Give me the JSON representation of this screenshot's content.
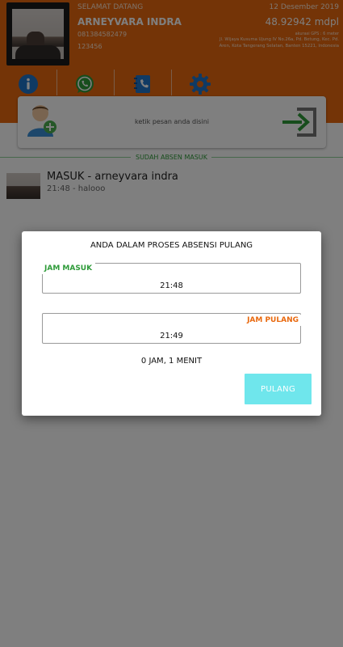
{
  "header": {
    "greeting": "SELAMAT DATANG",
    "user_name": "ARNEYVARA INDRA",
    "phone": "081384582479",
    "user_id": "123456",
    "date": "12 Desember 2019",
    "altitude": "48.92942 mdpl",
    "gps_accuracy": "akurasi GPS : 6 meter",
    "address": "Jl. Wijaya Kusuma Ujung IV No.26a, Pd. Betung, Kec. Pd. Aren, Kota Tangerang Selatan, Banten 15221, Indonesia"
  },
  "toolbar": {
    "icons": [
      "info-icon",
      "whatsapp-icon",
      "contact-book-icon",
      "gear-icon"
    ]
  },
  "message_bar": {
    "placeholder": "ketik pesan anda disini"
  },
  "status": {
    "absen_label": "SUDAH ABSEN MASUK"
  },
  "list": {
    "items": [
      {
        "title": "MASUK - arneyvara indra",
        "subtitle": "21:48 - halooo"
      }
    ]
  },
  "dialog": {
    "title": "ANDA DALAM PROSES ABSENSI PULANG",
    "jam_masuk_label": "JAM MASUK",
    "jam_masuk_value": "21:48",
    "jam_pulang_label": "JAM PULANG",
    "jam_pulang_value": "21:49",
    "duration": "0 JAM, 1 MENIT",
    "button_label": "PULANG"
  },
  "colors": {
    "header_bg": "#e9690f",
    "accent_green": "#2e9b39",
    "accent_orange": "#e9690f",
    "button_bg": "#6fe6ec",
    "icon_blue": "#1f74c8"
  }
}
